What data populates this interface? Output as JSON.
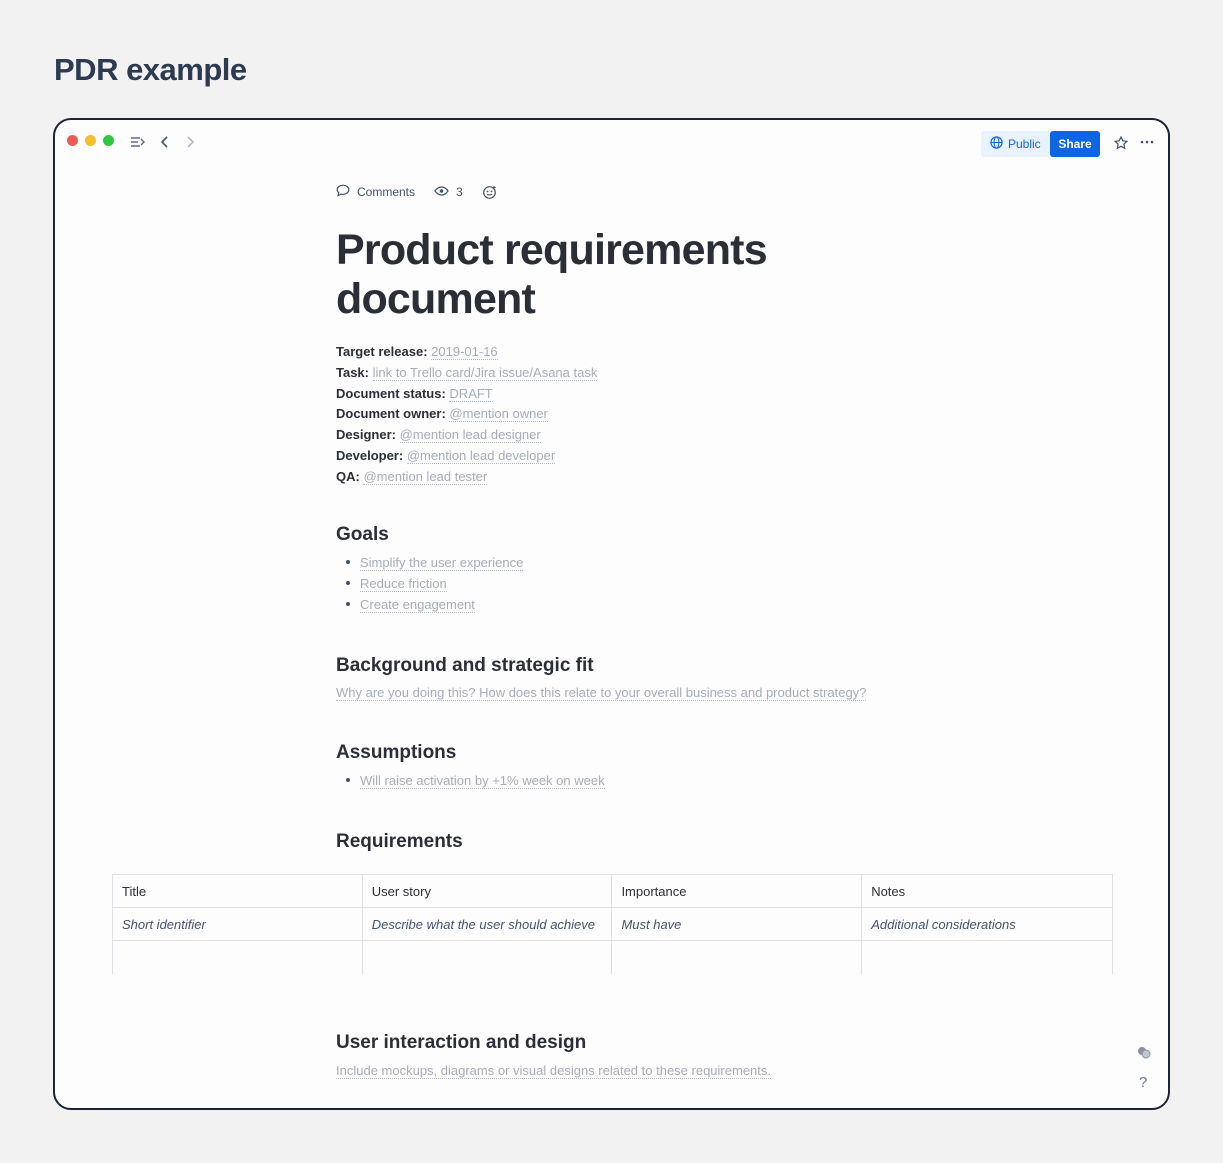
{
  "frame_title": "PDR example",
  "toolbar": {
    "public_label": "Public",
    "share_label": "Share"
  },
  "meta": {
    "comments_label": "Comments",
    "view_count": "3"
  },
  "doc_title": "Product requirements document",
  "properties": [
    {
      "key": "Target release",
      "value": "2019-01-16"
    },
    {
      "key": "Task",
      "value": "link to Trello card/Jira issue/Asana task"
    },
    {
      "key": "Document status",
      "value": "DRAFT"
    },
    {
      "key": "Document owner",
      "value": "@mention owner"
    },
    {
      "key": "Designer",
      "value": "@mention lead designer"
    },
    {
      "key": "Developer",
      "value": "@mention lead developer"
    },
    {
      "key": "QA",
      "value": "@mention lead tester"
    }
  ],
  "goals": {
    "heading": "Goals",
    "items": [
      "Simplify the user experience",
      "Reduce friction",
      "Create engagement"
    ]
  },
  "background": {
    "heading": "Background and strategic fit",
    "text": "Why are you doing this? How does this relate to your overall business and product strategy?"
  },
  "assumptions": {
    "heading": "Assumptions",
    "items": [
      "Will raise activation by +1% week on week"
    ]
  },
  "requirements": {
    "heading": "Requirements",
    "columns": [
      "Title",
      "User story",
      "Importance",
      "Notes"
    ],
    "rows": [
      [
        "Short identifier",
        "Describe what the user should achieve",
        "Must have",
        "Additional considerations"
      ],
      [
        "",
        "",
        "",
        ""
      ]
    ]
  },
  "design": {
    "heading": "User interaction and design",
    "text": "Include mockups, diagrams or visual designs related to these requirements."
  },
  "help_label": "?"
}
